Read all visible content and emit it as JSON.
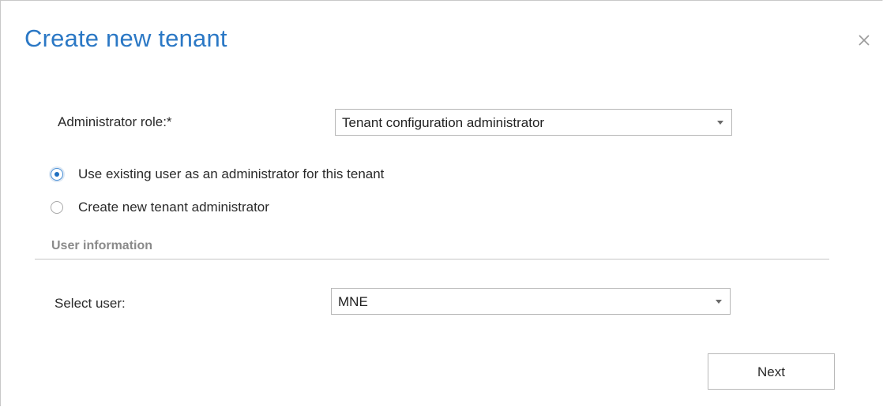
{
  "dialog": {
    "title": "Create new tenant",
    "close_icon": "close-icon"
  },
  "form": {
    "admin_role_label": "Administrator role:*",
    "admin_role_value": "Tenant configuration administrator",
    "radio_options": [
      {
        "label": "Use existing user as an administrator for this tenant",
        "checked": true
      },
      {
        "label": "Create new tenant administrator",
        "checked": false
      }
    ],
    "section_title": "User information",
    "select_user_label": "Select user:",
    "select_user_value": "MNE"
  },
  "actions": {
    "next_label": "Next"
  },
  "colors": {
    "title": "#2b78c5",
    "radio_selected": "#1f6fc0",
    "section_title": "#8a8a8a"
  }
}
